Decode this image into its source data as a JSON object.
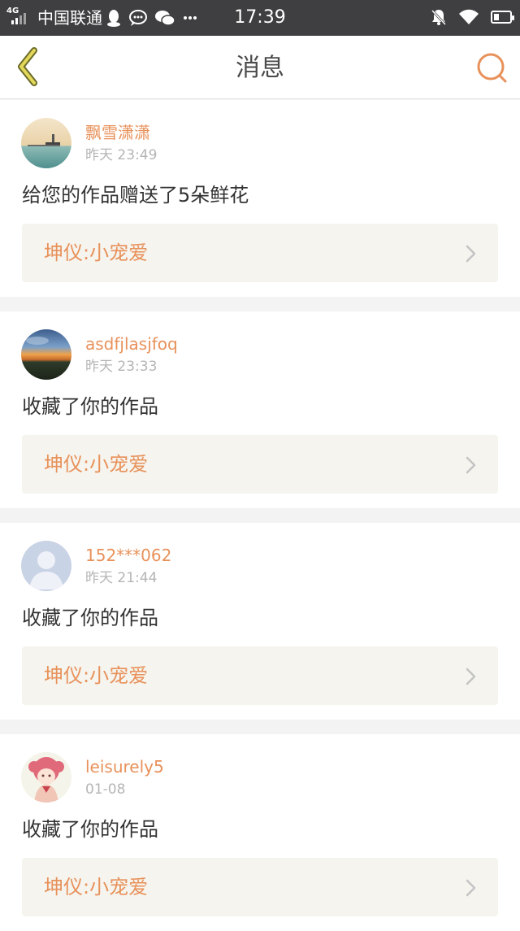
{
  "status_bar": {
    "network": "4G",
    "carrier": "中国联通",
    "time": "17:39",
    "left_icons": [
      "qq-icon",
      "message-icon",
      "wechat-icon",
      "more-dots-icon"
    ],
    "right_icons": [
      "mute-bell-icon",
      "wifi-icon",
      "battery-icon"
    ]
  },
  "nav": {
    "title": "消息",
    "back_icon": "chevron-left-icon",
    "search_icon": "search-icon"
  },
  "colors": {
    "accent": "#e8915a",
    "back_chevron": "#cfc03a",
    "text": "#333333",
    "muted": "#b5b5b5",
    "work_link_bg": "#f5f4ee"
  },
  "messages": [
    {
      "username": "飘雪潇潇",
      "time": "昨天 23:49",
      "text": "给您的作品赠送了5朵鲜花",
      "work": "坤仪:小宠爱",
      "avatar": "sea-lighthouse"
    },
    {
      "username": "asdfjlasjfoq",
      "time": "昨天 23:33",
      "text": "收藏了你的作品",
      "work": "坤仪:小宠爱",
      "avatar": "sunset"
    },
    {
      "username": "152***062",
      "time": "昨天 21:44",
      "text": "收藏了你的作品",
      "work": "坤仪:小宠爱",
      "avatar": "default-person"
    },
    {
      "username": "leisurely5",
      "time": "01-08",
      "text": "收藏了你的作品",
      "work": "坤仪:小宠爱",
      "avatar": "anime-girl"
    }
  ]
}
